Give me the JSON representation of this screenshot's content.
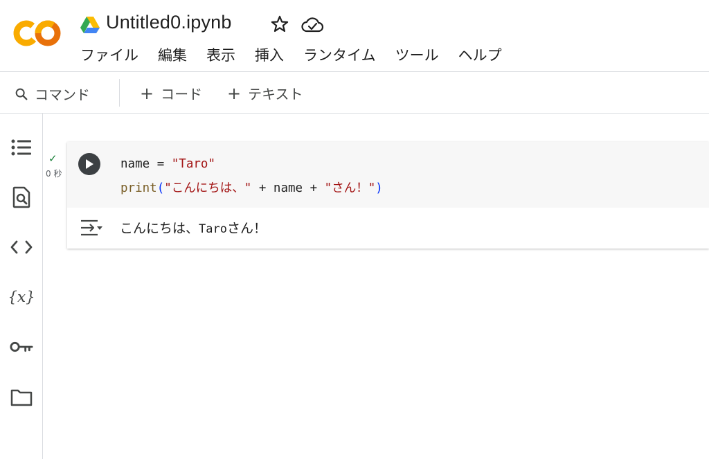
{
  "header": {
    "title": "Untitled0.ipynb",
    "logo_text": "CO",
    "menu": [
      "ファイル",
      "編集",
      "表示",
      "挿入",
      "ランタイム",
      "ツール",
      "ヘルプ"
    ]
  },
  "toolbar": {
    "command_label": "コマンド",
    "add_code_label": "コード",
    "add_text_label": "テキスト"
  },
  "sidebar": {
    "icons": [
      "table-of-contents-icon",
      "find-icon",
      "code-snippets-icon",
      "variables-icon",
      "secrets-key-icon",
      "files-folder-icon"
    ]
  },
  "cell": {
    "status": "✓",
    "exec_time": "0 秒",
    "code_line1": {
      "var": "name",
      "op": " = ",
      "str": "\"Taro\""
    },
    "code_line2": {
      "fn": "print",
      "open": "(",
      "str1": "\"こんにちは、\"",
      "mid1": " + name + ",
      "str2": "\"さん！\"",
      "close": ")"
    },
    "output_part1": "こんにちは、",
    "output_part2": "Taro",
    "output_part3": "さん！"
  },
  "colors": {
    "logo_orange": "#f9ab00",
    "logo_dark_orange": "#e8710a",
    "string": "#a31515",
    "function": "#795e26",
    "paren": "#0431fa",
    "check": "#188038"
  }
}
